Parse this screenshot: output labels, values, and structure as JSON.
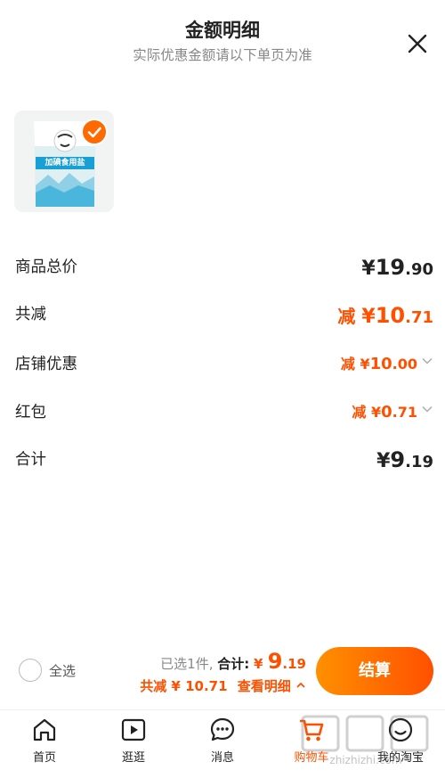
{
  "header": {
    "title": "金额明细",
    "subtitle": "实际优惠金额请以下单页为准"
  },
  "icons": {
    "close": "close-icon",
    "check": "check-icon",
    "chevron": "chevron-down-icon",
    "chevron_up": "chevron-up-icon"
  },
  "product": {
    "image": "salt-package-image",
    "package_text": "加碘食用盐",
    "checked": true
  },
  "details": [
    {
      "label": "商品总价",
      "prefix": "",
      "currency": "¥",
      "integer": "19",
      "decimal": ".90",
      "color": "#222222",
      "has_chevron": false
    },
    {
      "label": "共减",
      "prefix": "减 ",
      "currency": "¥",
      "integer": "10",
      "decimal": ".71",
      "color": "#ff5000",
      "has_chevron": false
    },
    {
      "label": "店铺优惠",
      "prefix": "减 ",
      "currency": "¥",
      "integer": "10",
      "decimal": ".00",
      "color": "#ff5000",
      "has_chevron": true
    },
    {
      "label": "红包",
      "prefix": "减 ",
      "currency": "¥",
      "integer": "0",
      "decimal": ".71",
      "color": "#ff5000",
      "has_chevron": true
    },
    {
      "label": "合计",
      "prefix": "",
      "currency": "¥",
      "integer": "9",
      "decimal": ".19",
      "color": "#222222",
      "has_chevron": false
    }
  ],
  "bottom": {
    "select_all": "全选",
    "selected_count": "已选1件,",
    "total_label": "合计:",
    "total_currency": "¥",
    "total_integer": "9",
    "total_decimal": ".19",
    "discount_text": "共减 ¥ 10.71",
    "view_detail": "查看明细",
    "checkout": "结算"
  },
  "tabs": [
    {
      "label": "首页",
      "icon": "home-icon",
      "active": false
    },
    {
      "label": "逛逛",
      "icon": "video-play-icon",
      "active": false
    },
    {
      "label": "消息",
      "icon": "message-icon",
      "active": false
    },
    {
      "label": "购物车",
      "icon": "cart-icon",
      "active": true
    },
    {
      "label": "我的淘宝",
      "icon": "profile-icon",
      "active": false
    }
  ],
  "watermark": "zhizhizhi.com",
  "colors": {
    "accent": "#ff5000",
    "accent_gradient_start": "#ff9000",
    "text": "#222222",
    "muted": "#888888"
  }
}
